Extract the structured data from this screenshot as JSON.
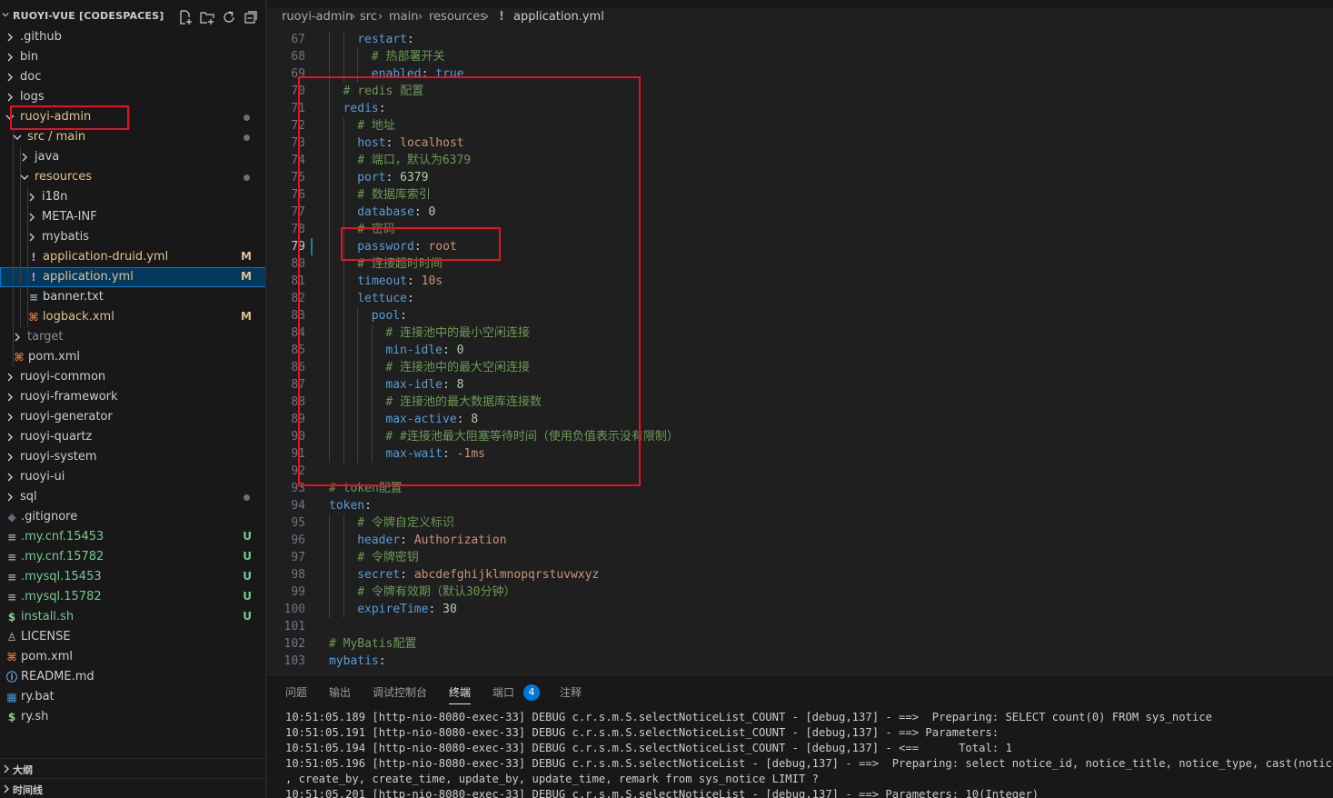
{
  "explorer": {
    "title": "RUOYI-VUE [CODESPACES]",
    "actions": [
      "new-file-icon",
      "new-folder-icon",
      "refresh-icon",
      "collapse-all-icon"
    ],
    "items": [
      {
        "label": ".github",
        "kind": "folder",
        "depth": 0,
        "open": false
      },
      {
        "label": "bin",
        "kind": "folder",
        "depth": 0,
        "open": false
      },
      {
        "label": "doc",
        "kind": "folder",
        "depth": 0,
        "open": false
      },
      {
        "label": "logs",
        "kind": "folder",
        "depth": 0,
        "open": false
      },
      {
        "label": "ruoyi-admin",
        "kind": "folder",
        "depth": 0,
        "open": true,
        "color": "#e2c08d",
        "dot": true
      },
      {
        "label": "src",
        "label2": "main",
        "kind": "folder",
        "depth": 1,
        "open": true,
        "color": "#e2c08d",
        "dot": true
      },
      {
        "label": "java",
        "kind": "folder",
        "depth": 2,
        "open": false
      },
      {
        "label": "resources",
        "kind": "folder",
        "depth": 2,
        "open": true,
        "color": "#e2c08d",
        "dot": true
      },
      {
        "label": "i18n",
        "kind": "folder",
        "depth": 3,
        "open": false
      },
      {
        "label": "META-INF",
        "kind": "folder",
        "depth": 3,
        "open": false
      },
      {
        "label": "mybatis",
        "kind": "folder",
        "depth": 3,
        "open": false
      },
      {
        "label": "application-druid.yml",
        "kind": "yml",
        "depth": 3,
        "color": "#e2c08d",
        "badge": "M"
      },
      {
        "label": "application.yml",
        "kind": "yml",
        "depth": 3,
        "color": "#e2c08d",
        "badge": "M",
        "selected": true
      },
      {
        "label": "banner.txt",
        "kind": "txt",
        "depth": 3
      },
      {
        "label": "logback.xml",
        "kind": "xml",
        "depth": 3,
        "color": "#e2c08d",
        "badge": "M"
      },
      {
        "label": "target",
        "kind": "folder",
        "depth": 1,
        "open": false,
        "color": "#8c8c8c"
      },
      {
        "label": "pom.xml",
        "kind": "xml",
        "depth": 1
      },
      {
        "label": "ruoyi-common",
        "kind": "folder",
        "depth": 0,
        "open": false
      },
      {
        "label": "ruoyi-framework",
        "kind": "folder",
        "depth": 0,
        "open": false
      },
      {
        "label": "ruoyi-generator",
        "kind": "folder",
        "depth": 0,
        "open": false
      },
      {
        "label": "ruoyi-quartz",
        "kind": "folder",
        "depth": 0,
        "open": false
      },
      {
        "label": "ruoyi-system",
        "kind": "folder",
        "depth": 0,
        "open": false
      },
      {
        "label": "ruoyi-ui",
        "kind": "folder",
        "depth": 0,
        "open": false
      },
      {
        "label": "sql",
        "kind": "folder",
        "depth": 0,
        "open": false,
        "dot": true
      },
      {
        "label": ".gitignore",
        "kind": "git",
        "depth": 0
      },
      {
        "label": ".my.cnf.15453",
        "kind": "txt",
        "depth": 0,
        "color": "#73c991",
        "badge": "U"
      },
      {
        "label": ".my.cnf.15782",
        "kind": "txt",
        "depth": 0,
        "color": "#73c991",
        "badge": "U"
      },
      {
        "label": ".mysql.15453",
        "kind": "txt",
        "depth": 0,
        "color": "#73c991",
        "badge": "U"
      },
      {
        "label": ".mysql.15782",
        "kind": "txt",
        "depth": 0,
        "color": "#73c991",
        "badge": "U"
      },
      {
        "label": "install.sh",
        "kind": "sh",
        "depth": 0,
        "color": "#73c991",
        "badge": "U"
      },
      {
        "label": "LICENSE",
        "kind": "license",
        "depth": 0
      },
      {
        "label": "pom.xml",
        "kind": "xml",
        "depth": 0
      },
      {
        "label": "README.md",
        "kind": "info",
        "depth": 0
      },
      {
        "label": "ry.bat",
        "kind": "bat",
        "depth": 0
      },
      {
        "label": "ry.sh",
        "kind": "sh",
        "depth": 0
      }
    ],
    "sections": [
      "大纲",
      "时间线"
    ]
  },
  "breadcrumb": [
    "ruoyi-admin",
    "src",
    "main",
    "resources",
    "application.yml"
  ],
  "editor": {
    "active_line": 79,
    "lines": [
      {
        "n": 67,
        "indent": 2,
        "parts": [
          [
            "k",
            "restart"
          ],
          [
            "p",
            ":"
          ]
        ]
      },
      {
        "n": 68,
        "indent": 3,
        "parts": [
          [
            "c",
            "# 热部署开关"
          ]
        ]
      },
      {
        "n": 69,
        "indent": 3,
        "parts": [
          [
            "k",
            "enabled"
          ],
          [
            "p",
            ": "
          ],
          [
            "k",
            "true"
          ]
        ]
      },
      {
        "n": 70,
        "indent": 1,
        "parts": [
          [
            "c",
            "# redis 配置"
          ]
        ]
      },
      {
        "n": 71,
        "indent": 1,
        "parts": [
          [
            "k",
            "redis"
          ],
          [
            "p",
            ":"
          ]
        ]
      },
      {
        "n": 72,
        "indent": 2,
        "parts": [
          [
            "c",
            "# 地址"
          ]
        ]
      },
      {
        "n": 73,
        "indent": 2,
        "parts": [
          [
            "k",
            "host"
          ],
          [
            "p",
            ": "
          ],
          [
            "v",
            "localhost"
          ]
        ]
      },
      {
        "n": 74,
        "indent": 2,
        "parts": [
          [
            "c",
            "# 端口，默认为6379"
          ]
        ]
      },
      {
        "n": 75,
        "indent": 2,
        "parts": [
          [
            "k",
            "port"
          ],
          [
            "p",
            ": "
          ],
          [
            "n",
            "6379"
          ]
        ]
      },
      {
        "n": 76,
        "indent": 2,
        "parts": [
          [
            "c",
            "# 数据库索引"
          ]
        ]
      },
      {
        "n": 77,
        "indent": 2,
        "parts": [
          [
            "k",
            "database"
          ],
          [
            "p",
            ": "
          ],
          [
            "n",
            "0"
          ]
        ]
      },
      {
        "n": 78,
        "indent": 2,
        "parts": [
          [
            "c",
            "# 密码"
          ]
        ]
      },
      {
        "n": 79,
        "indent": 2,
        "parts": [
          [
            "k",
            "password"
          ],
          [
            "p",
            ": "
          ],
          [
            "v",
            "root"
          ]
        ]
      },
      {
        "n": 80,
        "indent": 2,
        "parts": [
          [
            "c",
            "# 连接超时时间"
          ]
        ]
      },
      {
        "n": 81,
        "indent": 2,
        "parts": [
          [
            "k",
            "timeout"
          ],
          [
            "p",
            ": "
          ],
          [
            "v",
            "10s"
          ]
        ]
      },
      {
        "n": 82,
        "indent": 2,
        "parts": [
          [
            "k",
            "lettuce"
          ],
          [
            "p",
            ":"
          ]
        ]
      },
      {
        "n": 83,
        "indent": 3,
        "parts": [
          [
            "k",
            "pool"
          ],
          [
            "p",
            ":"
          ]
        ]
      },
      {
        "n": 84,
        "indent": 4,
        "parts": [
          [
            "c",
            "# 连接池中的最小空闲连接"
          ]
        ]
      },
      {
        "n": 85,
        "indent": 4,
        "parts": [
          [
            "k",
            "min-idle"
          ],
          [
            "p",
            ": "
          ],
          [
            "n",
            "0"
          ]
        ]
      },
      {
        "n": 86,
        "indent": 4,
        "parts": [
          [
            "c",
            "# 连接池中的最大空闲连接"
          ]
        ]
      },
      {
        "n": 87,
        "indent": 4,
        "parts": [
          [
            "k",
            "max-idle"
          ],
          [
            "p",
            ": "
          ],
          [
            "n",
            "8"
          ]
        ]
      },
      {
        "n": 88,
        "indent": 4,
        "parts": [
          [
            "c",
            "# 连接池的最大数据库连接数"
          ]
        ]
      },
      {
        "n": 89,
        "indent": 4,
        "parts": [
          [
            "k",
            "max-active"
          ],
          [
            "p",
            ": "
          ],
          [
            "n",
            "8"
          ]
        ]
      },
      {
        "n": 90,
        "indent": 4,
        "parts": [
          [
            "c",
            "# #连接池最大阻塞等待时间（使用负值表示没有限制）"
          ]
        ]
      },
      {
        "n": 91,
        "indent": 4,
        "parts": [
          [
            "k",
            "max-wait"
          ],
          [
            "p",
            ": "
          ],
          [
            "v",
            "-1ms"
          ]
        ]
      },
      {
        "n": 92,
        "indent": 0,
        "parts": []
      },
      {
        "n": 93,
        "indent": 0,
        "parts": [
          [
            "c",
            "# token配置"
          ]
        ]
      },
      {
        "n": 94,
        "indent": 0,
        "parts": [
          [
            "k",
            "token"
          ],
          [
            "p",
            ":"
          ]
        ]
      },
      {
        "n": 95,
        "indent": 2,
        "parts": [
          [
            "c",
            "# 令牌自定义标识"
          ]
        ]
      },
      {
        "n": 96,
        "indent": 2,
        "parts": [
          [
            "k",
            "header"
          ],
          [
            "p",
            ": "
          ],
          [
            "v",
            "Authorization"
          ]
        ]
      },
      {
        "n": 97,
        "indent": 2,
        "parts": [
          [
            "c",
            "# 令牌密钥"
          ]
        ]
      },
      {
        "n": 98,
        "indent": 2,
        "parts": [
          [
            "k",
            "secret"
          ],
          [
            "p",
            ": "
          ],
          [
            "v",
            "abcdefghijklmnopqrstuvwxyz"
          ]
        ]
      },
      {
        "n": 99,
        "indent": 2,
        "parts": [
          [
            "c",
            "# 令牌有效期（默认30分钟）"
          ]
        ]
      },
      {
        "n": 100,
        "indent": 2,
        "parts": [
          [
            "k",
            "expireTime"
          ],
          [
            "p",
            ": "
          ],
          [
            "n",
            "30"
          ]
        ]
      },
      {
        "n": 101,
        "indent": 0,
        "parts": []
      },
      {
        "n": 102,
        "indent": 0,
        "parts": [
          [
            "c",
            "# MyBatis配置"
          ]
        ]
      },
      {
        "n": 103,
        "indent": 0,
        "parts": [
          [
            "k",
            "mybatis"
          ],
          [
            "p",
            ":"
          ]
        ]
      }
    ]
  },
  "panel": {
    "tabs": [
      "问题",
      "输出",
      "调试控制台",
      "终端",
      "端口",
      "注释"
    ],
    "active_tab": "终端",
    "ports_count": "4",
    "terminal_lines": [
      "10:51:05.189 [http-nio-8080-exec-33] DEBUG c.r.s.m.S.selectNoticeList_COUNT - [debug,137] - ==>  Preparing: SELECT count(0) FROM sys_notice",
      "10:51:05.191 [http-nio-8080-exec-33] DEBUG c.r.s.m.S.selectNoticeList_COUNT - [debug,137] - ==> Parameters: ",
      "10:51:05.194 [http-nio-8080-exec-33] DEBUG c.r.s.m.S.selectNoticeList_COUNT - [debug,137] - <==      Total: 1",
      "10:51:05.196 [http-nio-8080-exec-33] DEBUG c.r.s.m.S.selectNoticeList - [debug,137] - ==>  Preparing: select notice_id, notice_title, notice_type, cast(notice_content as char) as notice_content, status",
      ", create_by, create_time, update_by, update_time, remark from sys_notice LIMIT ?",
      "10:51:05.201 [http-nio-8080-exec-33] DEBUG c.r.s.m.S.selectNoticeList - [debug,137] - ==> Parameters: 10(Integer)"
    ]
  },
  "colors": {
    "highlight_box": "#e81123",
    "modified": "#e2c08d",
    "untracked": "#73c991",
    "selection": "#04395e"
  }
}
